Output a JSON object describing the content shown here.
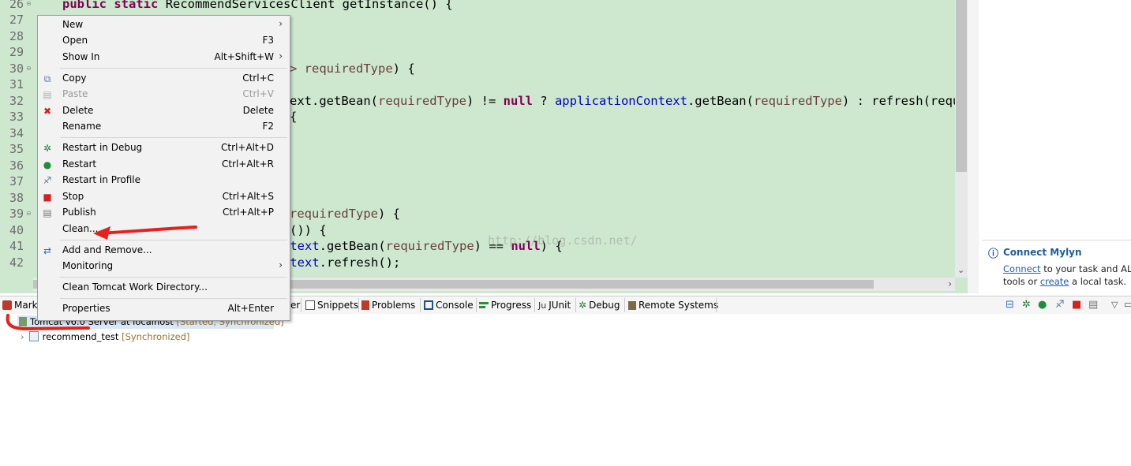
{
  "editor": {
    "line_numbers": [
      "26",
      "27",
      "28",
      "29",
      "30",
      "31",
      "32",
      "33",
      "34",
      "35",
      "36",
      "37",
      "38",
      "39",
      "40",
      "41",
      "42"
    ],
    "line26": {
      "kw1": "public",
      "kw2": "static",
      "rest": "RecommendServicesClient getInstance() {"
    },
    "line30": {
      "param": "> requiredType",
      "rest": ") {"
    },
    "line32": {
      "a": "ext.getBean(",
      "p1": "requiredType",
      "b": ") != ",
      "kw": "null",
      "c": " ? ",
      "f": "applicationContext",
      "d": ".getBean(",
      "p2": "requiredType",
      "e": ") : refresh(requ"
    },
    "line33": "{",
    "line39": {
      "p": "requiredType",
      "rest": ") {"
    },
    "line40": "()) {",
    "line41": {
      "f": "ntext",
      "a": ".getBean(",
      "p": "requiredType",
      "b": ") == ",
      "kw": "null",
      "c": ") {"
    },
    "line42": {
      "f": "ntext",
      "a": ".refresh();"
    },
    "watermark": "http://blog.csdn.net/"
  },
  "mylyn": {
    "title": "Connect Mylyn",
    "info_icon": "info-icon",
    "line1_link": "Connect",
    "line1_rest": " to your task and ALM",
    "line2_a": "tools or ",
    "line2_link": "create",
    "line2_b": " a local task."
  },
  "context_menu": {
    "items": [
      {
        "label": "New",
        "accel": "",
        "submenu": true,
        "icon": ""
      },
      {
        "label": "Open",
        "accel": "F3",
        "icon": ""
      },
      {
        "label": "Show In",
        "accel": "Alt+Shift+W",
        "submenu": true,
        "icon": ""
      },
      {
        "label": "Copy",
        "accel": "Ctrl+C",
        "icon": "copy-icon"
      },
      {
        "label": "Paste",
        "accel": "Ctrl+V",
        "icon": "paste-icon",
        "disabled": true
      },
      {
        "label": "Delete",
        "accel": "Delete",
        "icon": "delete-icon"
      },
      {
        "label": "Rename",
        "accel": "F2",
        "icon": ""
      },
      {
        "label": "Restart in Debug",
        "accel": "Ctrl+Alt+D",
        "icon": "debug-icon"
      },
      {
        "label": "Restart",
        "accel": "Ctrl+Alt+R",
        "icon": "run-icon"
      },
      {
        "label": "Restart in Profile",
        "accel": "",
        "icon": "profile-icon"
      },
      {
        "label": "Stop",
        "accel": "Ctrl+Alt+S",
        "icon": "stop-icon"
      },
      {
        "label": "Publish",
        "accel": "Ctrl+Alt+P",
        "icon": "publish-icon"
      },
      {
        "label": "Clean...",
        "accel": "",
        "icon": ""
      },
      {
        "label": "Add and Remove...",
        "accel": "",
        "icon": "add-remove-icon"
      },
      {
        "label": "Monitoring",
        "accel": "",
        "submenu": true,
        "icon": ""
      },
      {
        "label": "Clean Tomcat Work Directory...",
        "accel": "",
        "icon": ""
      },
      {
        "label": "Properties",
        "accel": "Alt+Enter",
        "icon": ""
      }
    ],
    "submenu_arrow": "›"
  },
  "tabs": {
    "markers": "Mark",
    "servers_tail": "er",
    "snippets": "Snippets",
    "problems": "Problems",
    "console": "Console",
    "progress": "Progress",
    "junit": "JUnit",
    "junit_prefix": "Ju",
    "debug": "Debug",
    "remote": "Remote Systems"
  },
  "servers": {
    "server_name": "Tomcat v6.0 Server at localhost",
    "server_status": "[Started, Synchronized]",
    "module_name": "recommend_test",
    "module_status": "[Synchronized]"
  },
  "colors": {
    "editor_bg": "#cde8cf",
    "keyword": "#7f0055",
    "field": "#0000c0",
    "annotation": "#e8201c"
  }
}
